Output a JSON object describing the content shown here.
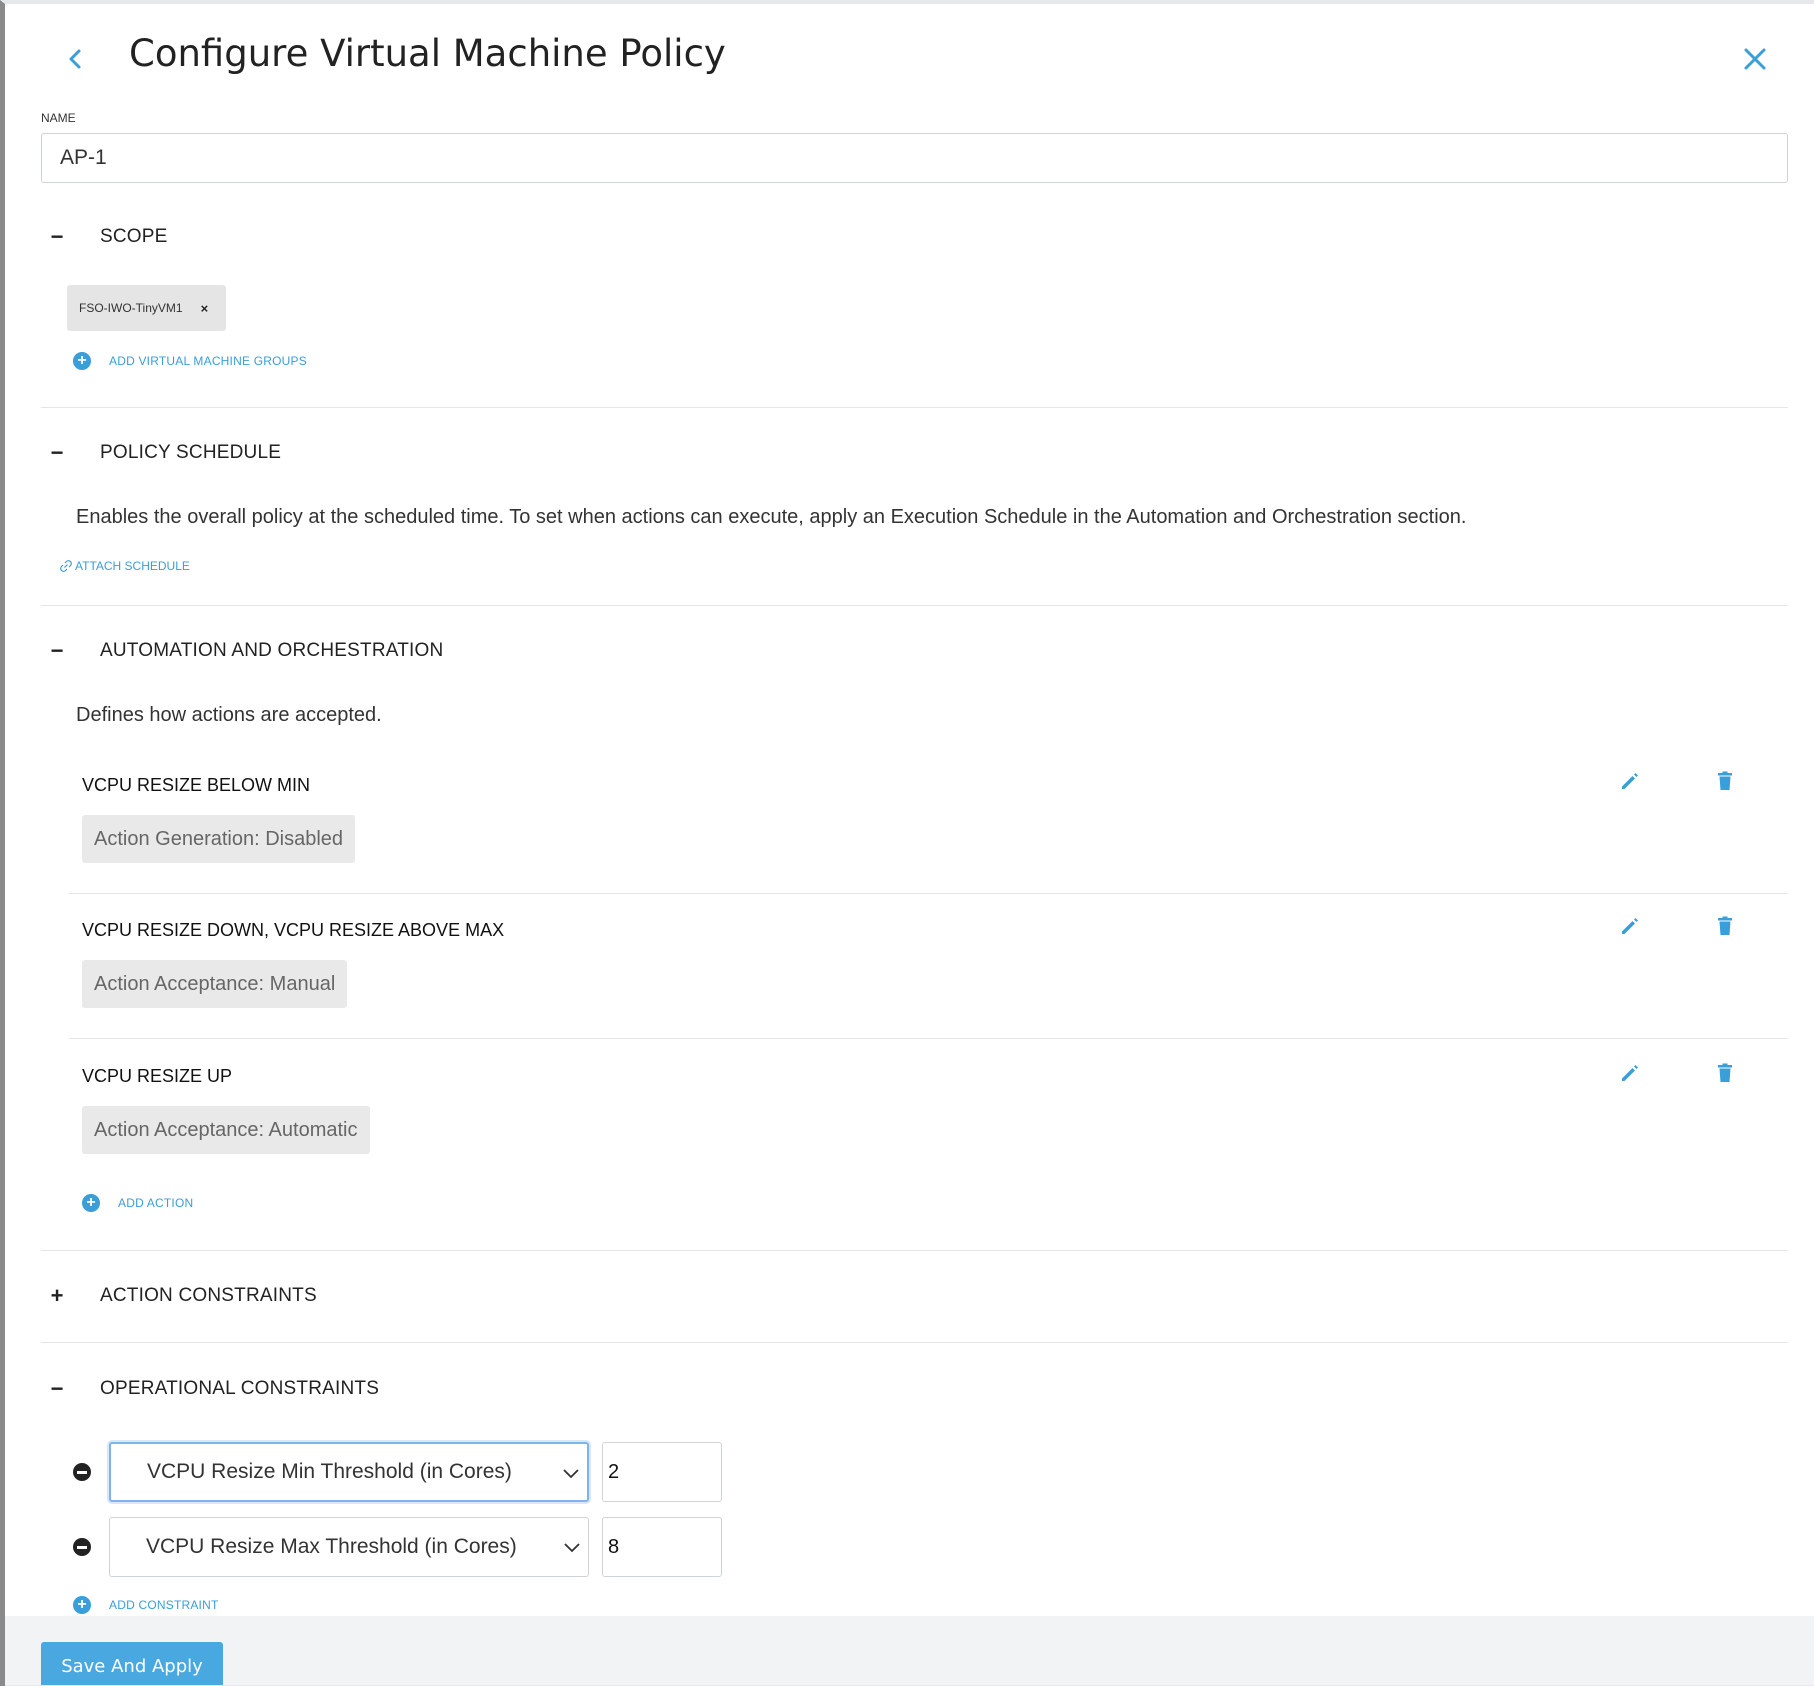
{
  "header": {
    "title": "Configure Virtual Machine Policy"
  },
  "name_field": {
    "label": "NAME",
    "value": "AP-1"
  },
  "scope": {
    "toggle": "−",
    "title": "SCOPE",
    "chips": [
      "FSO-IWO-TinyVM1"
    ],
    "chip_remove": "×",
    "add_link": "ADD VIRTUAL MACHINE GROUPS"
  },
  "policy_schedule": {
    "toggle": "−",
    "title": "POLICY SCHEDULE",
    "description": "Enables the overall policy at the scheduled time. To set when actions can execute, apply an Execution Schedule in the Automation and Orchestration section.",
    "attach_link": "ATTACH SCHEDULE"
  },
  "automation": {
    "toggle": "−",
    "title": "AUTOMATION AND ORCHESTRATION",
    "description": "Defines how actions are accepted.",
    "rows": [
      {
        "title": "VCPU RESIZE BELOW MIN",
        "badge": "Action Generation: Disabled"
      },
      {
        "title": "VCPU RESIZE DOWN, VCPU RESIZE ABOVE MAX",
        "badge": "Action Acceptance: Manual"
      },
      {
        "title": "VCPU RESIZE UP",
        "badge": "Action Acceptance: Automatic"
      }
    ],
    "add_link": "ADD ACTION"
  },
  "action_constraints": {
    "toggle": "+",
    "title": "ACTION CONSTRAINTS"
  },
  "operational_constraints": {
    "toggle": "−",
    "title": "OPERATIONAL CONSTRAINTS",
    "constraints": [
      {
        "label": "VCPU Resize Min Threshold (in Cores)",
        "value": "2"
      },
      {
        "label": "VCPU Resize Max Threshold (in Cores)",
        "value": "8"
      }
    ],
    "add_link": "ADD CONSTRAINT"
  },
  "footer": {
    "save_label": "Save And Apply"
  },
  "colors": {
    "accent": "#3a9ed8",
    "primary_button": "#4aa8e0",
    "badge_bg": "#e9e9e9",
    "chip_bg": "#e5e5e5"
  },
  "icons": {
    "back": "chevron-left-icon",
    "close": "close-icon",
    "edit": "pencil-icon",
    "delete": "trash-icon",
    "add": "plus-circle-icon",
    "remove": "minus-circle-icon",
    "attach": "link-icon",
    "dropdown": "chevron-down-icon"
  }
}
